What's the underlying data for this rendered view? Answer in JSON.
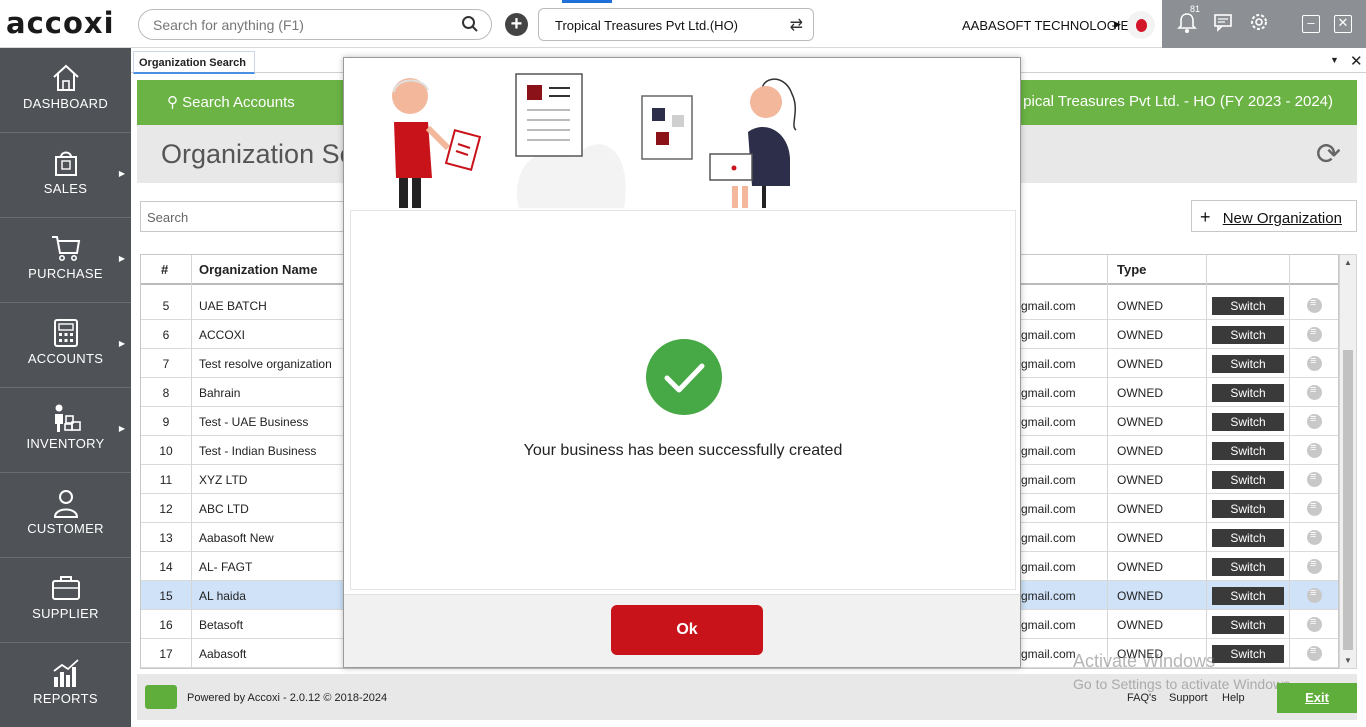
{
  "app": {
    "logo": "accoxi",
    "search_placeholder": "Search for anything (F1)",
    "org_selector": "Tropical Treasures Pvt Ltd.(HO)",
    "company": "AABASOFT TECHNOLOGIES",
    "notification_count": "81"
  },
  "sidebar": {
    "items": [
      {
        "label": "DASHBOARD",
        "icon": "home-icon"
      },
      {
        "label": "SALES",
        "icon": "shopping-bag-icon"
      },
      {
        "label": "PURCHASE",
        "icon": "cart-icon"
      },
      {
        "label": "ACCOUNTS",
        "icon": "calculator-icon"
      },
      {
        "label": "INVENTORY",
        "icon": "worker-boxes-icon"
      },
      {
        "label": "CUSTOMER",
        "icon": "person-icon"
      },
      {
        "label": "SUPPLIER",
        "icon": "briefcase-icon"
      },
      {
        "label": "REPORTS",
        "icon": "chart-icon"
      }
    ]
  },
  "tab": {
    "label": "Organization Search"
  },
  "header": {
    "search_accounts": "Search Accounts",
    "fy": "pical Treasures Pvt Ltd. - HO (FY 2023 - 2024)",
    "title": "Organization Se"
  },
  "list": {
    "search_placeholder": "Search",
    "new_org_label": "New Organization",
    "columns": {
      "num": "#",
      "name": "Organization Name",
      "type": "Type"
    },
    "switch_label": "Switch",
    "rows": [
      {
        "num": "5",
        "name": "UAE BATCH",
        "mail": "gmail.com",
        "type": "OWNED"
      },
      {
        "num": "6",
        "name": "ACCOXI",
        "mail": "gmail.com",
        "type": "OWNED"
      },
      {
        "num": "7",
        "name": "Test resolve organization",
        "mail": "gmail.com",
        "type": "OWNED"
      },
      {
        "num": "8",
        "name": "Bahrain",
        "mail": "gmail.com",
        "type": "OWNED"
      },
      {
        "num": "9",
        "name": "Test - UAE Business",
        "mail": "gmail.com",
        "type": "OWNED"
      },
      {
        "num": "10",
        "name": "Test - Indian Business",
        "mail": "gmail.com",
        "type": "OWNED"
      },
      {
        "num": "11",
        "name": "XYZ LTD",
        "mail": "gmail.com",
        "type": "OWNED"
      },
      {
        "num": "12",
        "name": "ABC LTD",
        "mail": "gmail.com",
        "type": "OWNED"
      },
      {
        "num": "13",
        "name": "Aabasoft New",
        "mail": "gmail.com",
        "type": "OWNED"
      },
      {
        "num": "14",
        "name": "AL- FAGT",
        "mail": "gmail.com",
        "type": "OWNED"
      },
      {
        "num": "15",
        "name": "AL haida",
        "mail": "gmail.com",
        "type": "OWNED"
      },
      {
        "num": "16",
        "name": "Betasoft",
        "mail": "gmail.com",
        "type": "OWNED"
      },
      {
        "num": "17",
        "name": "Aabasoft",
        "mail": "gmail.com",
        "type": "OWNED"
      }
    ],
    "selected_row": "15"
  },
  "footer": {
    "powered": "Powered by Accoxi - 2.0.12 © 2018-2024",
    "faq": "FAQ's",
    "support": "Support",
    "help": "Help",
    "exit": "Exit",
    "watermark_title": "Activate Windows",
    "watermark_sub": "Go to Settings to activate Windows."
  },
  "modal": {
    "message": "Your business has been successfully created",
    "ok_label": "Ok"
  },
  "colors": {
    "accent_green": "#6ab344",
    "sidebar_bg": "#4f5257",
    "ok_red": "#c8131b",
    "success_green": "#47a846"
  }
}
